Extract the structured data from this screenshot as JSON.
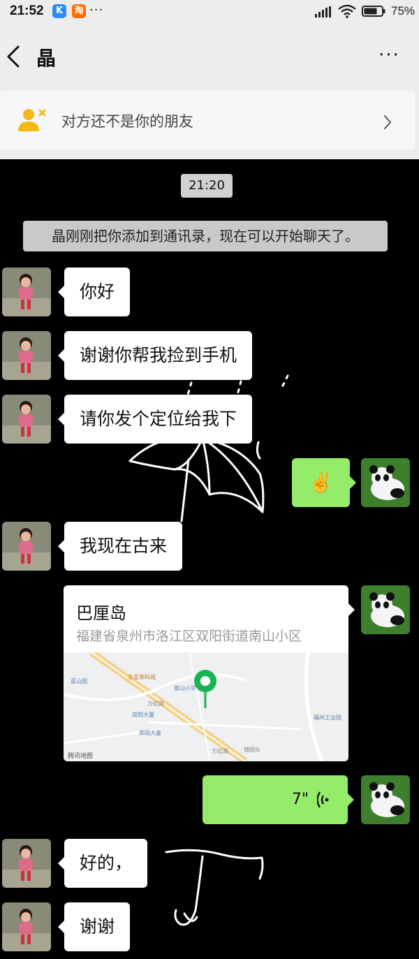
{
  "status_bar": {
    "time": "21:52",
    "app_icons": [
      "kugou-icon",
      "taobao-icon"
    ],
    "overflow": "···",
    "battery_percent": "75%",
    "battery_level": 0.75
  },
  "header": {
    "title": "晶",
    "more": "···"
  },
  "notice": {
    "text": "对方还不是你的朋友"
  },
  "chat": {
    "timestamp": "21:20",
    "system_message": "晶刚刚把你添加到通讯录，现在可以开始聊天了。",
    "messages": [
      {
        "from": "other",
        "text": "你好"
      },
      {
        "from": "other",
        "text": "谢谢你帮我捡到手机"
      },
      {
        "from": "other",
        "text": "请你发个定位给我下"
      },
      {
        "from": "me",
        "text": "✌️"
      },
      {
        "from": "other",
        "text": "我现在古来"
      },
      {
        "from": "me",
        "type": "location",
        "title": "巴厘岛",
        "address": "福建省泉州市洛江区双阳街道南山小区"
      },
      {
        "from": "me",
        "type": "voice",
        "duration": "7\""
      },
      {
        "from": "other",
        "text": "好的，"
      },
      {
        "from": "other",
        "text": "谢谢"
      }
    ]
  },
  "map": {
    "credit": "腾讯地图",
    "labels": [
      "蓝山园",
      "东亚茶料城",
      "南山小学",
      "万虹路",
      "双阳大厦",
      "荣阳大厦",
      "万虹路",
      "锦园头",
      "福州工业园"
    ]
  },
  "colors": {
    "chat_background": "#000000",
    "my_bubble": "#95ec69",
    "their_bubble": "#ffffff",
    "header_background": "#ededed"
  }
}
